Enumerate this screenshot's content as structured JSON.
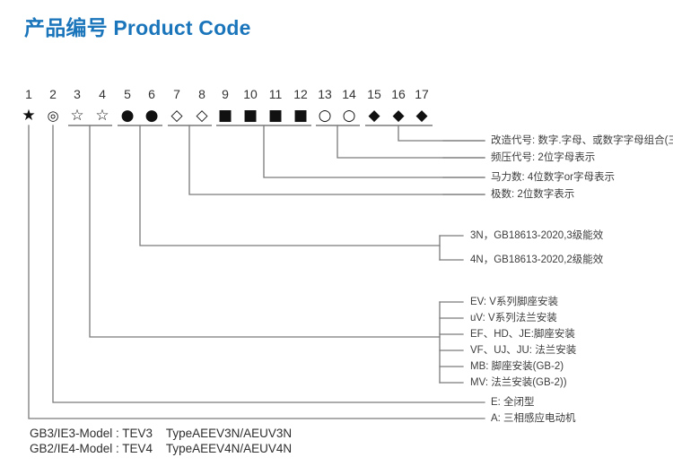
{
  "page": {
    "title": "产品编号 Product Code",
    "title_color": "#1b75bb",
    "line_color": "#7a7a7a",
    "text_color": "#3d3d3d"
  },
  "positions": [
    {
      "number": "1",
      "symbol": "★",
      "symbol_name": "filled-star"
    },
    {
      "number": "2",
      "symbol": "◎",
      "symbol_name": "double-circle"
    },
    {
      "number": "3",
      "symbol": "☆",
      "symbol_name": "open-star"
    },
    {
      "number": "4",
      "symbol": "☆",
      "symbol_name": "open-star"
    },
    {
      "number": "5",
      "symbol": "●",
      "symbol_name": "filled-circle"
    },
    {
      "number": "6",
      "symbol": "●",
      "symbol_name": "filled-circle"
    },
    {
      "number": "7",
      "symbol": "◇",
      "symbol_name": "open-diamond"
    },
    {
      "number": "8",
      "symbol": "◇",
      "symbol_name": "open-diamond"
    },
    {
      "number": "9",
      "symbol": "■",
      "symbol_name": "filled-square"
    },
    {
      "number": "10",
      "symbol": "■",
      "symbol_name": "filled-square"
    },
    {
      "number": "11",
      "symbol": "■",
      "symbol_name": "filled-square"
    },
    {
      "number": "12",
      "symbol": "■",
      "symbol_name": "filled-square"
    },
    {
      "number": "13",
      "symbol": "○",
      "symbol_name": "open-circle"
    },
    {
      "number": "14",
      "symbol": "○",
      "symbol_name": "open-circle"
    },
    {
      "number": "15",
      "symbol": "◆",
      "symbol_name": "filled-diamond"
    },
    {
      "number": "16",
      "symbol": "◆",
      "symbol_name": "filled-diamond"
    },
    {
      "number": "17",
      "symbol": "◆",
      "symbol_name": "filled-diamond"
    }
  ],
  "annotations": {
    "modification_code": "改造代号: 数字.字母、或数字字母组合(三位)",
    "voltage_code": "频压代号: 2位字母表示",
    "horsepower": "马力数: 4位数字or字母表示",
    "poles": "极数: 2位数字表示"
  },
  "efficiency": [
    "3N，GB18613-2020,3级能效",
    "4N，GB18613-2020,2级能效"
  ],
  "mounting": [
    "EV: V系列脚座安装",
    "uV: V系列法兰安装",
    "EF、HD、JE:脚座安装",
    "VF、UJ、JU: 法兰安装",
    "MB: 脚座安装(GB-2)",
    "MV: 法兰安装(GB-2))"
  ],
  "enclosure": "E: 全闭型",
  "motor_type": "A: 三相感应电动机",
  "models": [
    "GB3/IE3-Model : TEV3    TypeAEEV3N/AEUV3N",
    "GB2/IE4-Model : TEV4    TypeAEEV4N/AEUV4N"
  ]
}
